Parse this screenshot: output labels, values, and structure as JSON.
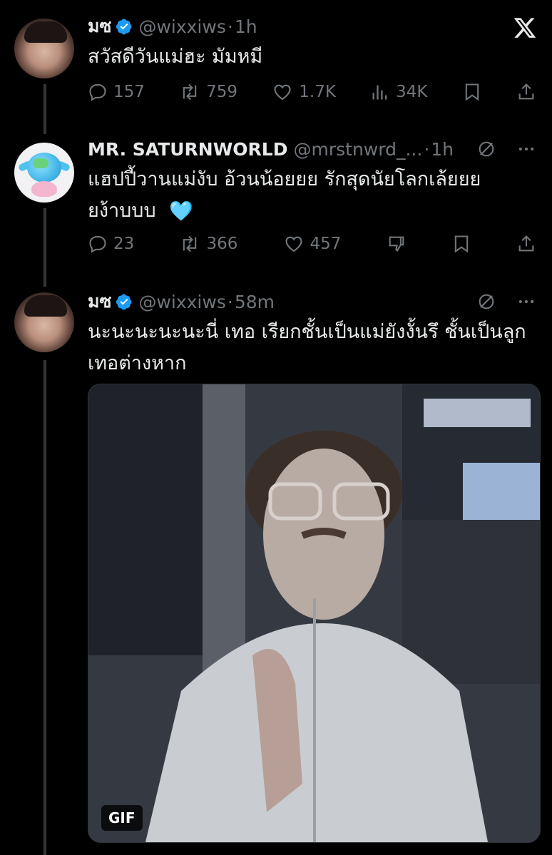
{
  "tweets": [
    {
      "name": "มซ",
      "handle": "@wixxiws",
      "time": "1h",
      "text": "สวัสดีวันแม่ฮะ มัมหมี",
      "stats": {
        "replies": "157",
        "reposts": "759",
        "likes": "1.7K",
        "views": "34K"
      }
    },
    {
      "name": "MR. SATURNWORLD",
      "handle": "@mrstnwrd_...",
      "time": "1h",
      "text": "แฮปปี้วานแม่งับ อ้วนน้อยยย รักสุดนัยโลกเล้ยยย ยง้าบบบ",
      "emoji": "🩵",
      "stats": {
        "replies": "23",
        "reposts": "366",
        "likes": "457"
      }
    },
    {
      "name": "มซ",
      "handle": "@wixxiws",
      "time": "58m",
      "text": "นะนะนะนะนะนี่ เทอ เรียกชั้นเป็นแม่ยังงั้นรึ ชั้นเป็นลูกเทอต่างหาก",
      "media_badge": "GIF"
    }
  ],
  "icons": {
    "close": "x-logo-icon",
    "verified_color": "#1d9bf0"
  }
}
